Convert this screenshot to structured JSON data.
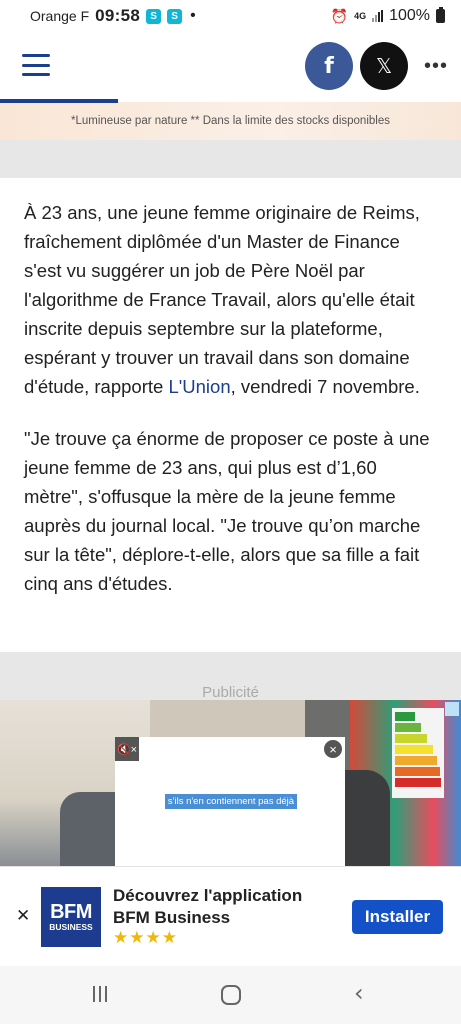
{
  "status_bar": {
    "carrier": "Orange F",
    "time": "09:58",
    "notif_icon": "S",
    "network": "4G",
    "battery": "100%"
  },
  "nav": {
    "facebook_glyph": "f",
    "x_glyph": "𝕏",
    "more": "•••"
  },
  "promo": {
    "text": "*Lumineuse par nature ** Dans la limite des stocks disponibles"
  },
  "article": {
    "p1_before": "À 23 ans, une jeune femme originaire de Reims, fraîchement diplômée d'un Master de Finance s'est vu suggérer un job de Père Noël par l'algorithme de France Travail, alors qu'elle était inscrite depuis septembre sur la plateforme, espérant y trouver un travail dans son domaine d'étude, rapporte ",
    "p1_link": "L'Union",
    "p1_after": ", vendredi 7 novembre.",
    "p2": "\"Je trouve ça énorme de proposer ce poste à une jeune femme de 23 ans, qui plus est d’1,60 mètre\", s'offusque la mère de la jeune femme auprès du journal local. \"Je trouve qu’on marche sur la tête\", déplore-t-elle, alors que sa fille a fait cinq ans d'études."
  },
  "ad": {
    "label": "Publicité",
    "video_caption": "s'ils n'en contiennent pas déjà",
    "mute_glyph": "🔇×",
    "close_glyph": "×"
  },
  "app_banner": {
    "close_glyph": "✕",
    "logo_line1": "BFM",
    "logo_line2": "BUSINESS",
    "title": "Découvrez l'application BFM Business",
    "stars": "★★★★",
    "install_label": "Installer"
  },
  "colors": {
    "brand_blue": "#1c3e8f",
    "install_blue": "#1450c8",
    "facebook": "#3b5998",
    "star": "#f2b705"
  }
}
